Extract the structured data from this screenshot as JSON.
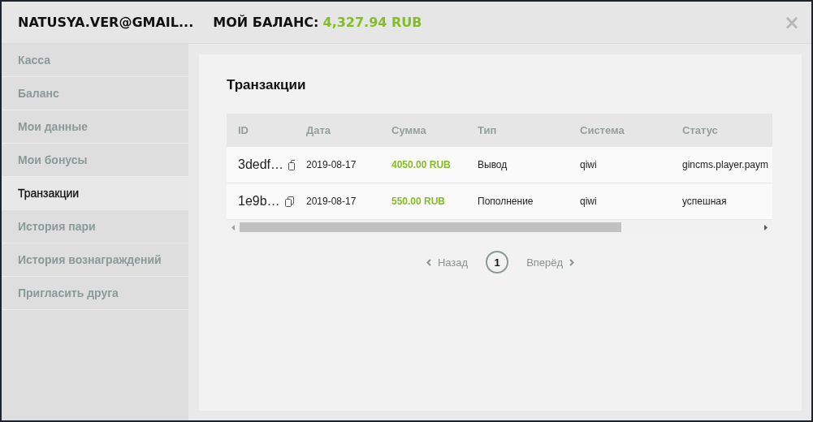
{
  "header": {
    "user": "NATUSYA.VER@GMAIL...",
    "balance_label": "МОЙ БАЛАНС:",
    "balance_value": "4,327.94 RUB",
    "close": "×"
  },
  "sidebar": {
    "items": [
      {
        "label": "Касса",
        "selected": false
      },
      {
        "label": "Баланс",
        "selected": false
      },
      {
        "label": "Мои данные",
        "selected": false
      },
      {
        "label": "Мои бонусы",
        "selected": false
      },
      {
        "label": "Транзакции",
        "selected": true
      },
      {
        "label": "История пари",
        "selected": false
      },
      {
        "label": "История вознаграждений",
        "selected": false
      },
      {
        "label": "Пригласить друга",
        "selected": false
      }
    ]
  },
  "content": {
    "title": "Транзакции",
    "table": {
      "columns": [
        "ID",
        "Дата",
        "Сумма",
        "Тип",
        "Система",
        "Статус"
      ],
      "rows": [
        {
          "id": "3dedf…",
          "date": "2019-08-17",
          "amount": "4050.00 RUB",
          "type": "Вывод",
          "system": "qiwi",
          "status": "gincms.player.paym"
        },
        {
          "id": "1e9b…",
          "date": "2019-08-17",
          "amount": "550.00 RUB",
          "type": "Пополнение",
          "system": "qiwi",
          "status": "успешная"
        }
      ]
    },
    "pagination": {
      "prev": "Назад",
      "pages": [
        {
          "label": "1",
          "selected": true
        }
      ],
      "next": "Вперёд"
    }
  }
}
